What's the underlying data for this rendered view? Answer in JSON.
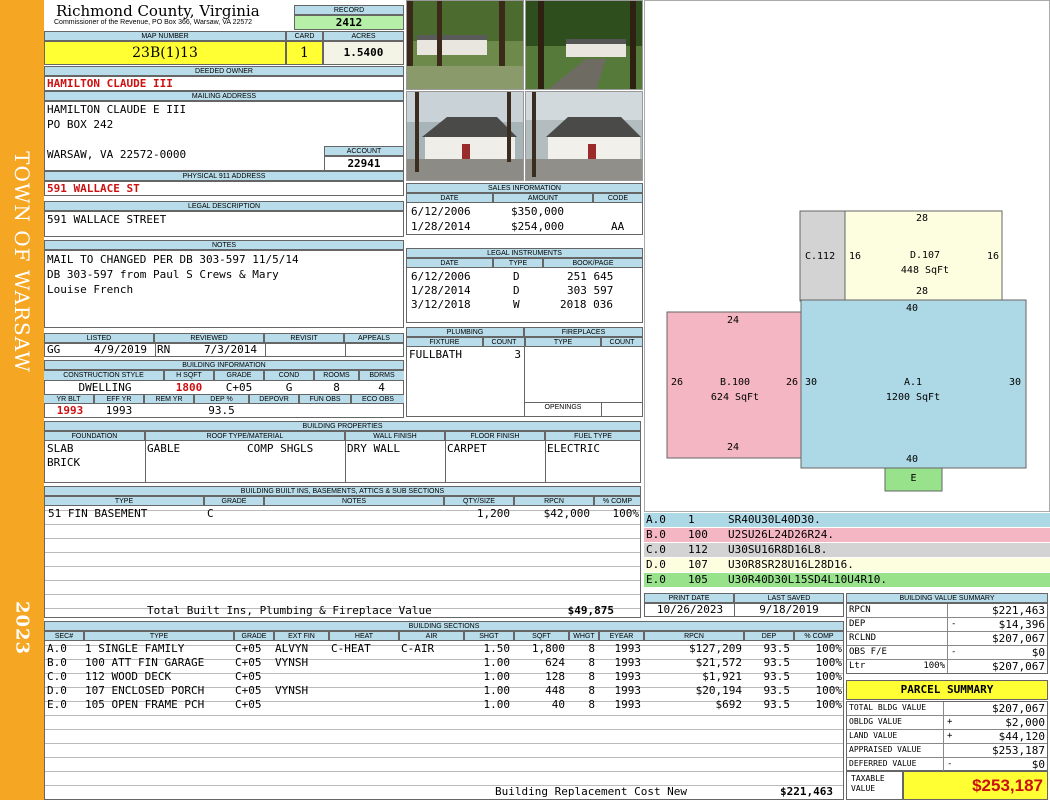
{
  "sidebar": {
    "town": "TOWN OF WARSAW",
    "year": "2023"
  },
  "header": {
    "county": "Richmond County, Virginia",
    "commissioner": "Commissioner of the Revenue, PO Box 366, Warsaw, VA 22572",
    "record_label": "RECORD",
    "record": "2412",
    "map_number_label": "MAP NUMBER",
    "map_number": "23B(1)13",
    "card_label": "CARD",
    "card": "1",
    "acres_label": "ACRES",
    "acres": "1.5400"
  },
  "owner": {
    "deeded_label": "DEEDED OWNER",
    "deeded_owner": "HAMILTON CLAUDE III",
    "mailing_label": "MAILING ADDRESS",
    "mailing": [
      "HAMILTON CLAUDE E III",
      "PO BOX 242",
      "",
      "WARSAW, VA 22572-0000"
    ],
    "account_label": "ACCOUNT",
    "account": "22941",
    "physical_label": "PHYSICAL 911 ADDRESS",
    "physical": "591 WALLACE ST",
    "legal_label": "LEGAL DESCRIPTION",
    "legal": "591 WALLACE STREET",
    "notes_label": "NOTES",
    "notes": [
      "MAIL TO CHANGED PER DB 303-597 11/5/14",
      "DB 303-597 from Paul S Crews & Mary",
      "Louise French"
    ]
  },
  "review": {
    "listed_label": "LISTED",
    "reviewed_label": "REVIEWED",
    "revisit_label": "REVISIT",
    "appeals_label": "APPEALS",
    "listed_by": "GG",
    "listed": "4/9/2019",
    "reviewed_by": "RN",
    "reviewed": "7/3/2014"
  },
  "building_info": {
    "label": "BUILDING INFORMATION",
    "headers": [
      "CONSTRUCTION STYLE",
      "H SQFT",
      "GRADE",
      "COND",
      "ROOMS",
      "BDRMS"
    ],
    "style": "DWELLING",
    "hsqft": "1800",
    "grade": "C+05",
    "cond": "G",
    "rooms": "8",
    "bdrms": "4",
    "headers2": [
      "YR BLT",
      "EFF YR",
      "REM YR",
      "DEP %",
      "DEPOVR",
      "FUN OBS",
      "ECO OBS"
    ],
    "yr_blt": "1993",
    "eff_yr": "1993",
    "dep": "93.5"
  },
  "sales": {
    "label": "SALES INFORMATION",
    "headers": [
      "DATE",
      "AMOUNT",
      "CODE"
    ],
    "rows": [
      [
        "6/12/2006",
        "$350,000",
        ""
      ],
      [
        "1/28/2014",
        "$254,000",
        "AA"
      ]
    ]
  },
  "legal_instruments": {
    "label": "LEGAL INSTRUMENTS",
    "headers": [
      "DATE",
      "TYPE",
      "BOOK/PAGE"
    ],
    "rows": [
      [
        "6/12/2006",
        "D",
        "251 645"
      ],
      [
        "1/28/2014",
        "D",
        "303 597"
      ],
      [
        "3/12/2018",
        "W",
        "2018 036"
      ]
    ]
  },
  "plumbing": {
    "label": "PLUMBING",
    "headers": [
      "FIXTURE",
      "COUNT"
    ],
    "rows": [
      [
        "FULLBATH",
        "3"
      ]
    ]
  },
  "fireplaces": {
    "label": "FIREPLACES",
    "headers": [
      "TYPE",
      "COUNT"
    ],
    "openings_label": "OPENINGS"
  },
  "properties": {
    "label": "BUILDING PROPERTIES",
    "headers": [
      "FOUNDATION",
      "ROOF TYPE/MATERIAL",
      "WALL FINISH",
      "FLOOR FINISH",
      "FUEL TYPE"
    ],
    "foundation": [
      "SLAB",
      "BRICK"
    ],
    "roof_type": "GABLE",
    "roof_material": "COMP SHGLS",
    "wall": "DRY WALL",
    "floor": "CARPET",
    "fuel": "ELECTRIC"
  },
  "builtins": {
    "label": "BUILDING BUILT INS, BASEMENTS, ATTICS & SUB SECTIONS",
    "headers": [
      "TYPE",
      "GRADE",
      "NOTES",
      "QTY/SIZE",
      "RPCN",
      "% COMP"
    ],
    "rows": [
      [
        "51 FIN BASEMENT",
        "C",
        "",
        "1,200",
        "$42,000",
        "100%"
      ]
    ],
    "total_label": "Total Built Ins, Plumbing & Fireplace Value",
    "total": "$49,875"
  },
  "sections": {
    "label": "BUILDING SECTIONS",
    "headers": [
      "SEC#",
      "TYPE",
      "GRADE",
      "EXT FIN",
      "HEAT",
      "AIR",
      "SHGT",
      "SQFT",
      "WHGT",
      "EYEAR",
      "RPCN",
      "DEP",
      "% COMP"
    ],
    "rows": [
      [
        "A.0",
        "1 SINGLE FAMILY",
        "C+05",
        "ALVYN",
        "C-HEAT",
        "C-AIR",
        "1.50",
        "1,800",
        "8",
        "1993",
        "$127,209",
        "93.5",
        "100%"
      ],
      [
        "B.0",
        "100 ATT FIN GARAGE",
        "C+05",
        "VYNSH",
        "",
        "",
        "1.00",
        "624",
        "8",
        "1993",
        "$21,572",
        "93.5",
        "100%"
      ],
      [
        "C.0",
        "112 WOOD DECK",
        "C+05",
        "",
        "",
        "",
        "1.00",
        "128",
        "8",
        "1993",
        "$1,921",
        "93.5",
        "100%"
      ],
      [
        "D.0",
        "107 ENCLOSED PORCH",
        "C+05",
        "VYNSH",
        "",
        "",
        "1.00",
        "448",
        "8",
        "1993",
        "$20,194",
        "93.5",
        "100%"
      ],
      [
        "E.0",
        "105 OPEN FRAME PCH",
        "C+05",
        "",
        "",
        "",
        "1.00",
        "40",
        "8",
        "1993",
        "$692",
        "93.5",
        "100%"
      ]
    ],
    "replacement_label": "Building Replacement Cost New",
    "replacement": "$221,463"
  },
  "sketch": {
    "colors": {
      "A": "#add8e6",
      "B": "#f4b6c2",
      "C": "#d3d3d3",
      "D": "#fdfde0",
      "E": "#98e28c"
    },
    "A": {
      "label": "A.1",
      "area": "1200 SqFt",
      "top": "40",
      "bottom": "40",
      "left": "30",
      "right": "30"
    },
    "B": {
      "label": "B.100",
      "area": "624 SqFt",
      "top": "24",
      "bottom": "24",
      "left": "26",
      "right": "26"
    },
    "C": {
      "label": "C.112"
    },
    "D": {
      "label": "D.107",
      "area": "448 SqFt",
      "top": "28",
      "bottom": "28",
      "left": "16",
      "right": "16"
    },
    "E": {
      "label": "E"
    },
    "legend": [
      {
        "sec": "A.0",
        "code": "1",
        "path": "SR40U30L40D30."
      },
      {
        "sec": "B.0",
        "code": "100",
        "path": "U2SU26L24D26R24."
      },
      {
        "sec": "C.0",
        "code": "112",
        "path": "U30SU16R8D16L8."
      },
      {
        "sec": "D.0",
        "code": "107",
        "path": "U30R8SR28U16L28D16."
      },
      {
        "sec": "E.0",
        "code": "105",
        "path": "U30R40D30L15SD4L10U4R10."
      }
    ]
  },
  "dates": {
    "print_label": "PRINT DATE",
    "saved_label": "LAST SAVED",
    "print": "10/26/2023",
    "saved": "9/18/2019"
  },
  "value_summary": {
    "label": "BUILDING VALUE SUMMARY",
    "rows": [
      {
        "k": "RPCN",
        "op": "",
        "pct": "",
        "v": "$221,463"
      },
      {
        "k": "DEP",
        "op": "-",
        "pct": "",
        "v": "$14,396"
      },
      {
        "k": "RCLND",
        "op": "",
        "pct": "",
        "v": "$207,067"
      },
      {
        "k": "OBS F/E",
        "op": "-",
        "pct": "",
        "v": "$0"
      },
      {
        "k": "Ltr",
        "op": "",
        "pct": "100%",
        "v": "$207,067"
      }
    ]
  },
  "parcel_summary": {
    "label": "PARCEL SUMMARY",
    "rows": [
      {
        "k": "TOTAL BLDG VALUE",
        "op": "",
        "v": "$207,067"
      },
      {
        "k": "OBLDG VALUE",
        "op": "+",
        "v": "$2,000"
      },
      {
        "k": "LAND VALUE",
        "op": "+",
        "v": "$44,120"
      },
      {
        "k": "APPRAISED VALUE",
        "op": "",
        "v": "$253,187"
      },
      {
        "k": "DEFERRED VALUE",
        "op": "-",
        "v": "$0"
      }
    ],
    "taxable_label": "TAXABLE VALUE",
    "taxable": "$253,187"
  }
}
